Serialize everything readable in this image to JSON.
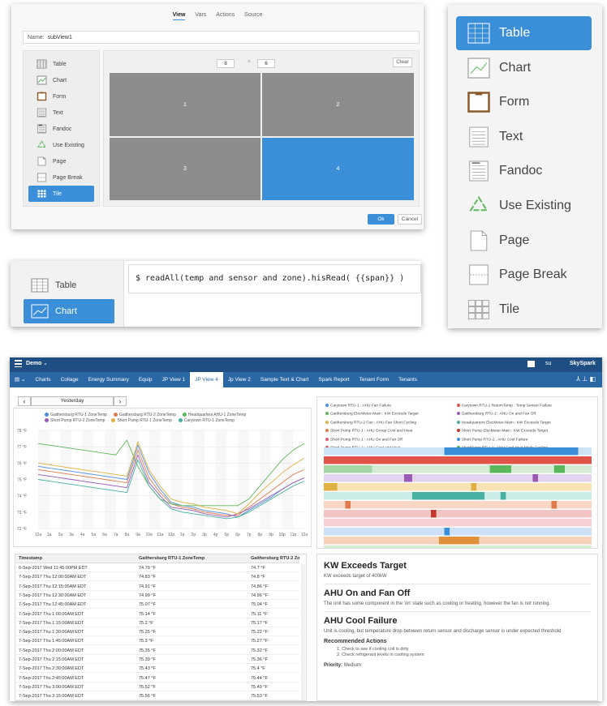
{
  "editor": {
    "tabs": [
      "View",
      "Vars",
      "Actions",
      "Source"
    ],
    "active_tab": "View",
    "name_label": "Name:",
    "name_value": "subView1",
    "menu": [
      "Table",
      "Chart",
      "Form",
      "Text",
      "Fandoc",
      "Use Existing",
      "Page",
      "Page Break",
      "Tile"
    ],
    "selected_menu": "Tile",
    "rows": "8",
    "cols": "6",
    "times_symbol": "×",
    "clear_label": "Clear",
    "tiles": [
      "1",
      "2",
      "3",
      "4"
    ],
    "selected_tile": "4",
    "ok_label": "Ok",
    "cancel_label": "Cancel"
  },
  "zoom_menu": {
    "items": [
      "Table",
      "Chart",
      "Form",
      "Text",
      "Fandoc",
      "Use Existing",
      "Page",
      "Page Break",
      "Tile"
    ],
    "selected": "Table"
  },
  "query_strip": {
    "items": [
      "Table",
      "Chart"
    ],
    "selected": "Chart",
    "query": "$ readAll(temp and sensor and zone).hisRead( {{span}} )"
  },
  "app": {
    "project": "Demo",
    "brand": "SkySpark",
    "user": "su",
    "nav_tabs": [
      "Charts",
      "Collage",
      "Energy Summary",
      "Equip",
      "JP View 1",
      "JP View 4",
      "Jp View 2",
      "Sample Text & Chart",
      "Spark Report",
      "Tenant Form",
      "Tenants"
    ],
    "active_tab": "JP View 4",
    "date_label": "Yesterday",
    "prev_icon": "‹",
    "next_icon": "›",
    "chart_legend": [
      {
        "name": "Gaithersburg RTU-1 ZoneTemp",
        "color": "#4a90d9"
      },
      {
        "name": "Gaithersburg RTU-2 ZoneTemp",
        "color": "#e07a4a"
      },
      {
        "name": "Headquarters AHU-1 ZoneTemp",
        "color": "#5cb85c"
      },
      {
        "name": "Short Pump RTU-2 ZoneTemp",
        "color": "#9b59b6"
      },
      {
        "name": "Short Pump RTU-1 ZoneTemp",
        "color": "#e0b040"
      },
      {
        "name": "Carytown RTU-1 ZoneTemp",
        "color": "#48b0a0"
      }
    ],
    "chart_data": {
      "type": "line",
      "categories": [
        "12a",
        "1a",
        "2a",
        "3a",
        "4a",
        "5a",
        "6a",
        "7a",
        "8a",
        "9a",
        "10a",
        "11a",
        "12p",
        "1p",
        "2p",
        "3p",
        "4p",
        "5p",
        "6p",
        "7p",
        "8p",
        "9p",
        "10p",
        "11p",
        "12a"
      ],
      "yticks": [
        "78 °F",
        "77 °F",
        "76 °F",
        "75 °F",
        "74 °F",
        "73 °F",
        "72 °F"
      ],
      "ylim": [
        72,
        78
      ],
      "series": [
        {
          "name": "Gaithersburg RTU-1 ZoneTemp",
          "color": "#4a90d9",
          "values": [
            75.8,
            75.7,
            75.6,
            75.5,
            75.4,
            75.3,
            75.2,
            75.1,
            75.0,
            77.1,
            75.4,
            74.4,
            73.6,
            73.4,
            73.3,
            73.1,
            73.0,
            72.9,
            72.7,
            73.1,
            73.5,
            73.9,
            74.4,
            74.8,
            75.1
          ]
        },
        {
          "name": "Gaithersburg RTU-2 ZoneTemp",
          "color": "#e07a4a",
          "values": [
            75.6,
            75.5,
            75.4,
            75.3,
            75.2,
            75.1,
            75.0,
            74.9,
            74.8,
            76.8,
            75.1,
            74.2,
            73.5,
            73.3,
            73.2,
            73.0,
            72.9,
            72.8,
            72.8,
            73.3,
            73.8,
            74.3,
            74.8,
            75.3,
            75.6
          ]
        },
        {
          "name": "Headquarters AHU-1 ZoneTemp",
          "color": "#5cb85c",
          "values": [
            77.2,
            77.1,
            77.0,
            76.9,
            76.8,
            76.7,
            76.6,
            76.5,
            77.4,
            75.8,
            74.6,
            73.8,
            73.5,
            73.4,
            73.4,
            73.4,
            73.4,
            73.4,
            73.4,
            73.8,
            74.6,
            75.4,
            76.2,
            76.8,
            77.2
          ]
        },
        {
          "name": "Short Pump RTU-2 ZoneTemp",
          "color": "#9b59b6",
          "values": [
            75.3,
            75.2,
            75.1,
            75.0,
            74.9,
            74.8,
            74.7,
            74.6,
            74.5,
            76.5,
            74.8,
            74.0,
            73.3,
            73.2,
            73.1,
            72.9,
            72.8,
            72.7,
            72.9,
            73.2,
            73.6,
            74.0,
            74.4,
            74.8,
            75.1
          ]
        },
        {
          "name": "Short Pump RTU-1 ZoneTemp",
          "color": "#e0b040",
          "values": [
            76.0,
            75.9,
            75.8,
            75.7,
            75.6,
            75.5,
            75.4,
            75.3,
            75.2,
            77.3,
            75.6,
            74.6,
            73.8,
            73.6,
            73.5,
            73.3,
            73.2,
            73.1,
            72.9,
            73.5,
            74.2,
            74.8,
            75.4,
            75.9,
            76.3
          ]
        },
        {
          "name": "Carytown RTU-1 ZoneTemp",
          "color": "#48b0a0",
          "values": [
            75.0,
            74.9,
            74.8,
            74.7,
            74.6,
            74.5,
            74.4,
            74.3,
            74.2,
            76.2,
            74.6,
            73.8,
            73.2,
            73.0,
            72.9,
            72.8,
            72.7,
            72.6,
            72.7,
            73.0,
            73.4,
            73.8,
            74.2,
            74.6,
            74.9
          ]
        }
      ]
    },
    "grid": {
      "columns": [
        "Timestamp",
        "Gaithersburg RTU-1 ZoneTemp",
        "Gaithersburg RTU-2 Zon"
      ],
      "rows": [
        [
          "6-Sep-2017 Wed 11:45:00PM EDT",
          "74.79 °F",
          "74.7 °F"
        ],
        [
          "7-Sep-2017 Thu 12:00:00AM EDT",
          "74.83 °F",
          "74.8 °F"
        ],
        [
          "7-Sep-2017 Thu 12:15:00AM EDT",
          "74.91 °F",
          "74.86 °F"
        ],
        [
          "7-Sep-2017 Thu 12:30:00AM EDT",
          "74.99 °F",
          "74.96 °F"
        ],
        [
          "7-Sep-2017 Thu 12:45:00AM EDT",
          "75.07 °F",
          "75.04 °F"
        ],
        [
          "7-Sep-2017 Thu 1:00:00AM EDT",
          "75.14 °F",
          "75.11 °F"
        ],
        [
          "7-Sep-2017 Thu 1:15:00AM EDT",
          "75.2 °F",
          "75.17 °F"
        ],
        [
          "7-Sep-2017 Thu 1:30:00AM EDT",
          "75.25 °F",
          "75.22 °F"
        ],
        [
          "7-Sep-2017 Thu 1:45:00AM EDT",
          "75.3 °F",
          "75.27 °F"
        ],
        [
          "7-Sep-2017 Thu 2:00:00AM EDT",
          "75.35 °F",
          "75.32 °F"
        ],
        [
          "7-Sep-2017 Thu 2:15:00AM EDT",
          "75.39 °F",
          "75.36 °F"
        ],
        [
          "7-Sep-2017 Thu 2:30:00AM EDT",
          "75.43 °F",
          "75.4 °F"
        ],
        [
          "7-Sep-2017 Thu 2:45:00AM EDT",
          "75.47 °F",
          "75.44 °F"
        ],
        [
          "7-Sep-2017 Thu 3:00:00AM EDT",
          "75.52 °F",
          "75.49 °F"
        ],
        [
          "7-Sep-2017 Thu 3:15:00AM EDT",
          "75.56 °F",
          "75.53 °F"
        ]
      ]
    },
    "gantt_legend": [
      {
        "name": "Carytown RTU-1 : AHU Fan Failure",
        "color": "#4a90d9"
      },
      {
        "name": "Carytown RTU-1 ReturnTemp : Temp Sensor Failure",
        "color": "#e0544a"
      },
      {
        "name": "Gaithersburg ElecMeter-Main : KW Exceeds Target",
        "color": "#5cb85c"
      },
      {
        "name": "Gaithersburg RTU-2 : AHU On and Fan Off",
        "color": "#9b59b6"
      },
      {
        "name": "Gaithersburg RTU-2 Fan : AHU Fan Short Cycling",
        "color": "#e0b040"
      },
      {
        "name": "Headquarters ElecMeter-Main : KW Exceeds Target",
        "color": "#48b0a0"
      },
      {
        "name": "Short Pump RTU-1 : AHU Group Cool and Heat",
        "color": "#e07a4a"
      },
      {
        "name": "Short Pump ElecMeter-Main : KW Exceeds Target",
        "color": "#c0392b"
      },
      {
        "name": "Short Pump RTU-1 : AHU On and Fan Off",
        "color": "#e05a6a"
      },
      {
        "name": "Short Pump RTU-2 : AHU Cool Failure",
        "color": "#3b8fd9"
      },
      {
        "name": "Short Pump RTU-2 : AHU Cool and Heat",
        "color": "#d9534f"
      },
      {
        "name": "ShortPump RTU-2 : AHU Cool Heat Mode Cycling",
        "color": "#4cae4c"
      }
    ],
    "alarms": [
      {
        "title": "KW Exceeds Target",
        "body": "KW exceeds target of 400kW"
      },
      {
        "title": "AHU On and Fan Off",
        "body": "The unit has some component in the 'on' state such as cooling or heating, however the fan is not running."
      },
      {
        "title": "AHU Cool Failure",
        "body": "Unit is cooling, but temperature drop between return sensor and discharge sensor is under expected threshold"
      }
    ],
    "recommended_label": "Recommended Actions",
    "recommended_items": [
      "1. Check to see if cooling coil is dirty",
      "2. Check refrigerant levels in cooling system"
    ],
    "priority_label": "Priority:",
    "priority_value": "Medium"
  },
  "colors": {
    "accent": "#3b8fd9",
    "topbar": "#1f4f82",
    "navbar": "#2a67a5",
    "tile_gray": "#8c8c8c"
  },
  "icons": {
    "Table": "table-icon",
    "Chart": "chart-icon",
    "Form": "form-icon",
    "Text": "text-icon",
    "Fandoc": "fandoc-icon",
    "Use Existing": "recycle-icon",
    "Page": "page-icon",
    "Page Break": "page-break-icon",
    "Tile": "tile-icon"
  }
}
